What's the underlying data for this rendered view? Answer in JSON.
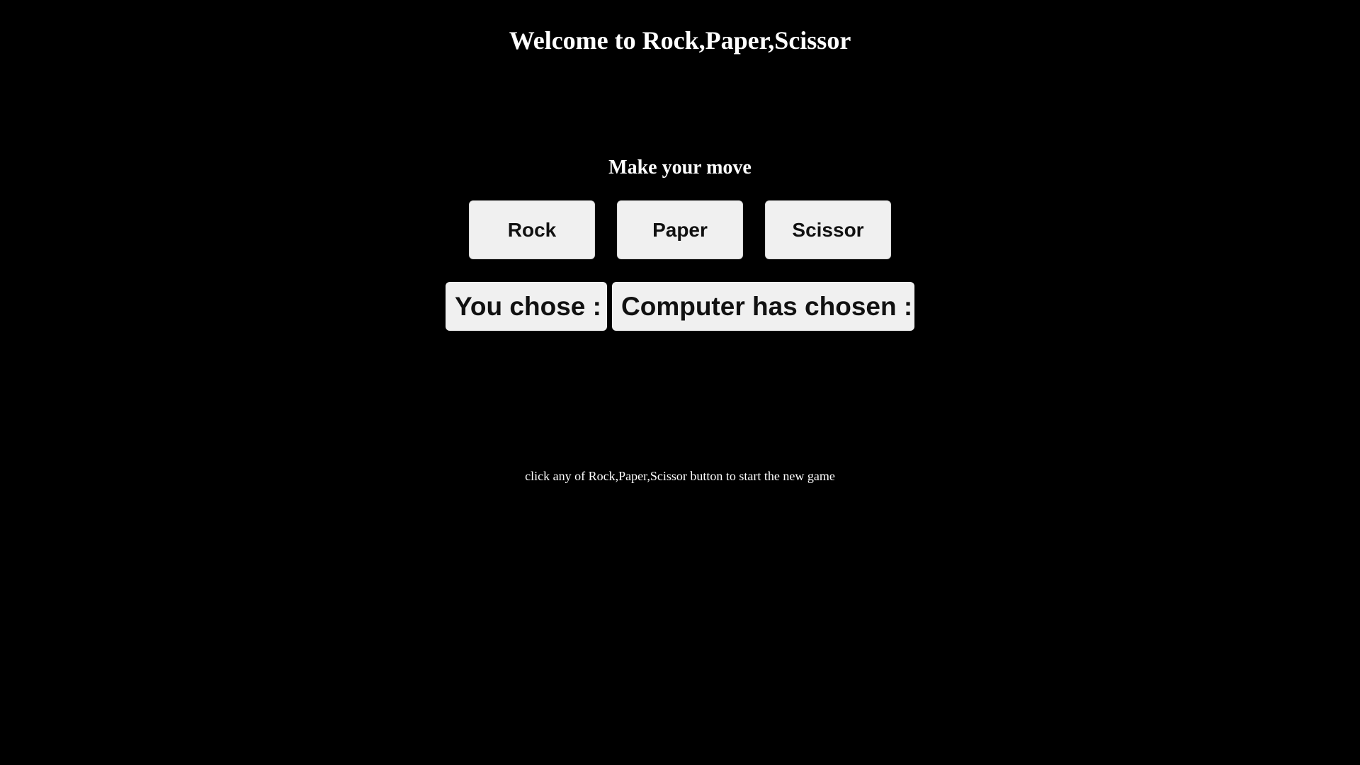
{
  "header": {
    "title": "Welcome to Rock,Paper,Scissor"
  },
  "game": {
    "prompt": "Make your move",
    "moves": [
      {
        "label": "Rock"
      },
      {
        "label": "Paper"
      },
      {
        "label": "Scissor"
      }
    ],
    "results": {
      "you_chose": "You chose :",
      "computer_chose": "Computer has chosen :"
    },
    "hint": "click any of Rock,Paper,Scissor button to start the new game"
  },
  "colors": {
    "background": "#000000",
    "text": "#ffffff",
    "button_bg": "#f0f0f0",
    "button_text": "#111111"
  }
}
